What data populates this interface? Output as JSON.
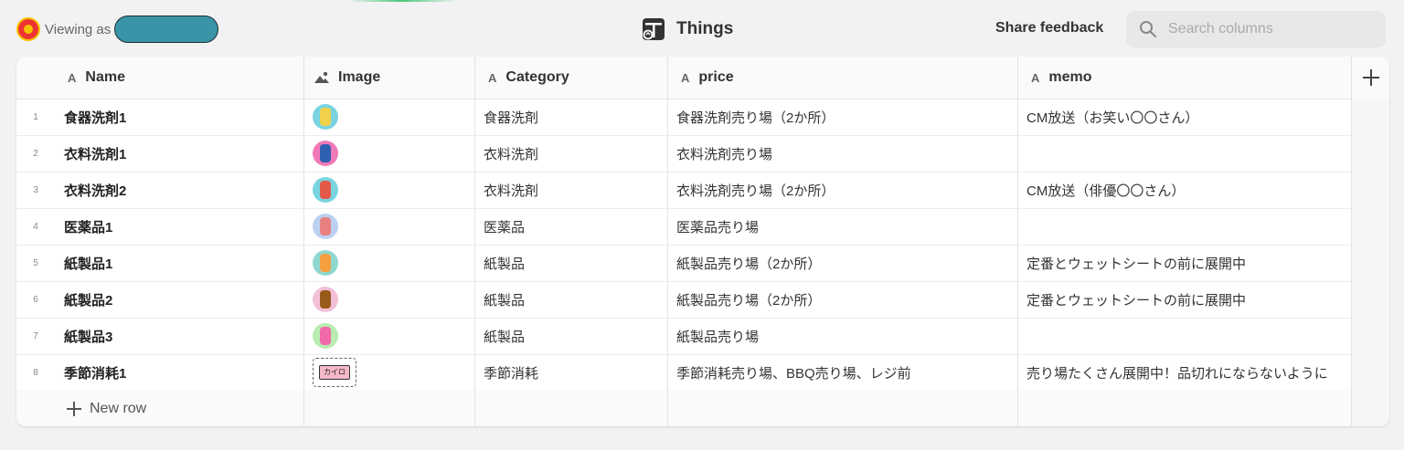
{
  "header": {
    "viewing_label": "Viewing as",
    "title": "Things",
    "share_label": "Share feedback",
    "search_placeholder": "Search columns"
  },
  "columns": [
    {
      "label": "Name",
      "type_icon": "text-type-icon"
    },
    {
      "label": "Image",
      "type_icon": "image-type-icon"
    },
    {
      "label": "Category",
      "type_icon": "text-type-icon"
    },
    {
      "label": "price",
      "type_icon": "text-type-icon"
    },
    {
      "label": "memo",
      "type_icon": "text-type-icon"
    }
  ],
  "type_glyph": "A",
  "rows": [
    {
      "num": "1",
      "name": "食器洗剤1",
      "image": "detergent-bottle-icon",
      "category": "食器洗剤",
      "price": "食器洗剤売り場（2か所）",
      "memo": "CM放送（お笑い〇〇さん）",
      "colors": [
        "#79d4e0",
        "#f2d24a"
      ]
    },
    {
      "num": "2",
      "name": "衣料洗剤1",
      "image": "laundry-detergent-icon",
      "category": "衣料洗剤",
      "price": "衣料洗剤売り場",
      "memo": "",
      "colors": [
        "#f07ab8",
        "#2f5fb0"
      ]
    },
    {
      "num": "3",
      "name": "衣料洗剤2",
      "image": "laundry-box-icon",
      "category": "衣料洗剤",
      "price": "衣料洗剤売り場（2か所）",
      "memo": "CM放送（俳優〇〇さん）",
      "colors": [
        "#79d4e0",
        "#e35a4a"
      ]
    },
    {
      "num": "4",
      "name": "医薬品1",
      "image": "pill-capsule-icon",
      "category": "医薬品",
      "price": "医薬品売り場",
      "memo": "",
      "colors": [
        "#bcd0f0",
        "#e88080"
      ]
    },
    {
      "num": "5",
      "name": "紙製品1",
      "image": "tissue-pack-icon",
      "category": "紙製品",
      "price": "紙製品売り場（2か所）",
      "memo": "定番とウェットシートの前に展開中",
      "colors": [
        "#8fd8d0",
        "#f5a040"
      ]
    },
    {
      "num": "6",
      "name": "紙製品2",
      "image": "tissue-box-icon",
      "category": "紙製品",
      "price": "紙製品売り場（2か所）",
      "memo": "定番とウェットシートの前に展開中",
      "colors": [
        "#f3c0d8",
        "#9a5a1a"
      ]
    },
    {
      "num": "7",
      "name": "紙製品3",
      "image": "wet-wipes-icon",
      "category": "紙製品",
      "price": "紙製品売り場",
      "memo": "",
      "colors": [
        "#b8ecb0",
        "#f06aa8"
      ]
    },
    {
      "num": "8",
      "name": "季節消耗1",
      "image": "heat-pack-icon",
      "category": "季節消耗",
      "price": "季節消耗売り場、BBQ売り場、レジ前",
      "memo": "売り場たくさん展開中！品切れにならないように",
      "colors": [
        "#ffffff",
        "#f4b8c8"
      ],
      "image_text": "カイロ"
    }
  ],
  "new_row_label": "New row",
  "colors": {
    "accent_user_pill": "#3a94a8",
    "background": "#f2f2f4"
  }
}
